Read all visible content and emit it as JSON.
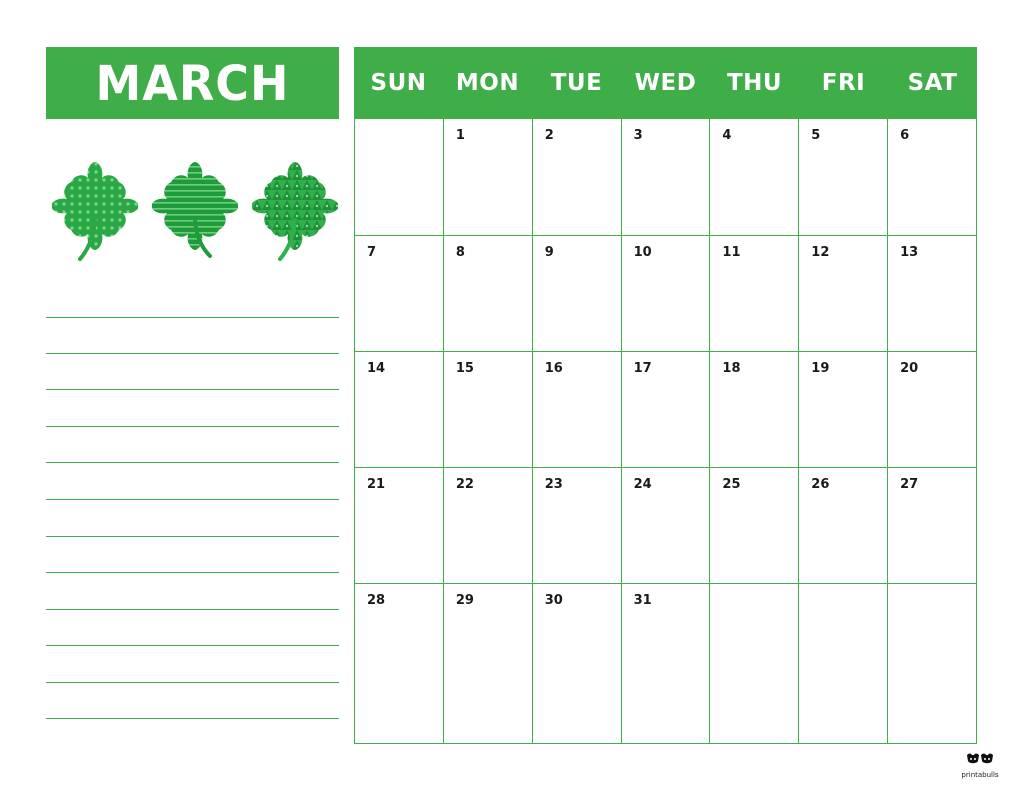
{
  "calendar": {
    "month": "MARCH",
    "weekdays": [
      "SUN",
      "MON",
      "TUE",
      "WED",
      "THU",
      "FRI",
      "SAT"
    ],
    "weeks": [
      [
        "",
        "1",
        "2",
        "3",
        "4",
        "5",
        "6"
      ],
      [
        "7",
        "8",
        "9",
        "10",
        "11",
        "12",
        "13"
      ],
      [
        "14",
        "15",
        "16",
        "17",
        "18",
        "19",
        "20"
      ],
      [
        "21",
        "22",
        "23",
        "24",
        "25",
        "26",
        "27"
      ],
      [
        "28",
        "29",
        "30",
        "31",
        "",
        "",
        ""
      ]
    ]
  },
  "decorations": {
    "icons": [
      "shamrock-dots-icon",
      "shamrock-stripes-icon",
      "shamrock-pattern-icon"
    ]
  },
  "notes": {
    "line_count": 12
  },
  "branding": {
    "text": "printabulls",
    "icon": "bull-logo-icon"
  },
  "colors": {
    "accent": "#3fae49",
    "clover_dark": "#1f8f3a",
    "clover_light": "#4cc35a",
    "text": "#1a1a1a"
  }
}
